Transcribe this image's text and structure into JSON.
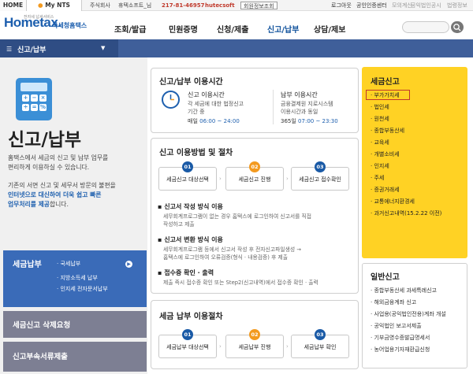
{
  "topbar": {
    "tabs": [
      "HOME",
      "My NTS"
    ],
    "company": "주식회사",
    "user": "휴텍소프트_님",
    "bizno": "217-81-46957",
    "bizname": "hutecsoft",
    "member_btn": "회원정보조회",
    "links": [
      "로그아웃",
      "공인인증센터",
      "모의계산",
      "공익법인공시",
      "법령정보"
    ]
  },
  "logo": {
    "main": "Hometax.",
    "kr": "국세청홈택스",
    "small": "전자세 납세서비스"
  },
  "nav": [
    "조회/발급",
    "민원증명",
    "신청/제출",
    "신고/납부",
    "상담/제보"
  ],
  "bar": {
    "title": "신고/납부"
  },
  "left": {
    "title": "신고/납부",
    "desc1": "홈택스에서 세금의 신고 및 납부 업무를",
    "desc2": "편리하게 이용하실 수 있습니다.",
    "desc3": "기존의 서면 신고 및 세무서 방문의 불편을",
    "desc4a": "인터넷으로 대신하여 더욱 쉽고 빠른",
    "desc5a": "업무처리를 제공",
    "desc5b": "합니다.",
    "sb1": {
      "title": "세금납부",
      "items": [
        "· 국세납부",
        "· 지방소득세 납부",
        "· 인지세 전자문서납부"
      ]
    },
    "sb2": "세금신고 삭제요청",
    "sb3": "신고부속서류제출"
  },
  "time_panel": {
    "title": "신고/납부 이용시간",
    "a_title": "신고 이용시간",
    "a_text1": "각 세금에 대한 법정신고",
    "a_text2": "기간 중",
    "a_day": "매일",
    "a_time": "06:00 ~ 24:00",
    "b_title": "납부 이용시간",
    "b_text1": "금융결제원 지로시스템",
    "b_text2": "이용시간과 동일",
    "b_day": "365일",
    "b_time": "07:00 ~ 23:30"
  },
  "method_panel": {
    "title": "신고 이용방법 및 절차",
    "steps": [
      {
        "num": "01",
        "label": "세금신고 대상선택"
      },
      {
        "num": "02",
        "label": "세금신고 진행"
      },
      {
        "num": "03",
        "label": "세금신고 접수확인"
      }
    ],
    "h1": "신고서 작성 방식 이용",
    "h1d1": "세무회계프로그램이 없는 경우 홈택스에 로그인하여 신고서를 직접",
    "h1d2": "작성하고 제출",
    "h2": "신고서 변환 방식 이용",
    "h2d1": "세무회계프로그램 등에서 신고서 작성 후 전자신고파일생성 →",
    "h2d2": "홈택스에 로그인하여 오류검증(형식 · 내용검증) 후 제출",
    "h3": "접수증 확인 · 출력",
    "h3d1": "제출 즉시 접수증 확인 또는 Step2(신고내역)에서 접수증 확인 · 출력"
  },
  "pay_panel": {
    "title": "세금 납부 이용절차",
    "steps": [
      {
        "num": "01",
        "label": "세금납부 대상선택"
      },
      {
        "num": "02",
        "label": "세금납부 진행"
      },
      {
        "num": "03",
        "label": "세금납부 확인"
      }
    ]
  },
  "right1": {
    "title": "세금신고",
    "items": [
      "부가가치세",
      "법인세",
      "원천세",
      "종합부동산세",
      "교육세",
      "개별소비세",
      "인지세",
      "주세",
      "증권거래세",
      "교통에너지환경세"
    ],
    "last": "· 과거신고내역(15.2.22 이전)"
  },
  "right2": {
    "title": "일반신고",
    "items": [
      "종합부동산세 과세특례신고",
      "해외금융계좌 신고",
      "사업용(공익법인전용)계좌 개설",
      "공익법인 보고서제출",
      "기부금영수증발급명세서",
      "농어업용기자재환급신청"
    ]
  },
  "colors": {
    "brand": "#1d5fae",
    "step1": "#1a5aa6",
    "step2": "#f39a1f",
    "step3": "#1a5aa6",
    "yellow": "#ffd224"
  }
}
